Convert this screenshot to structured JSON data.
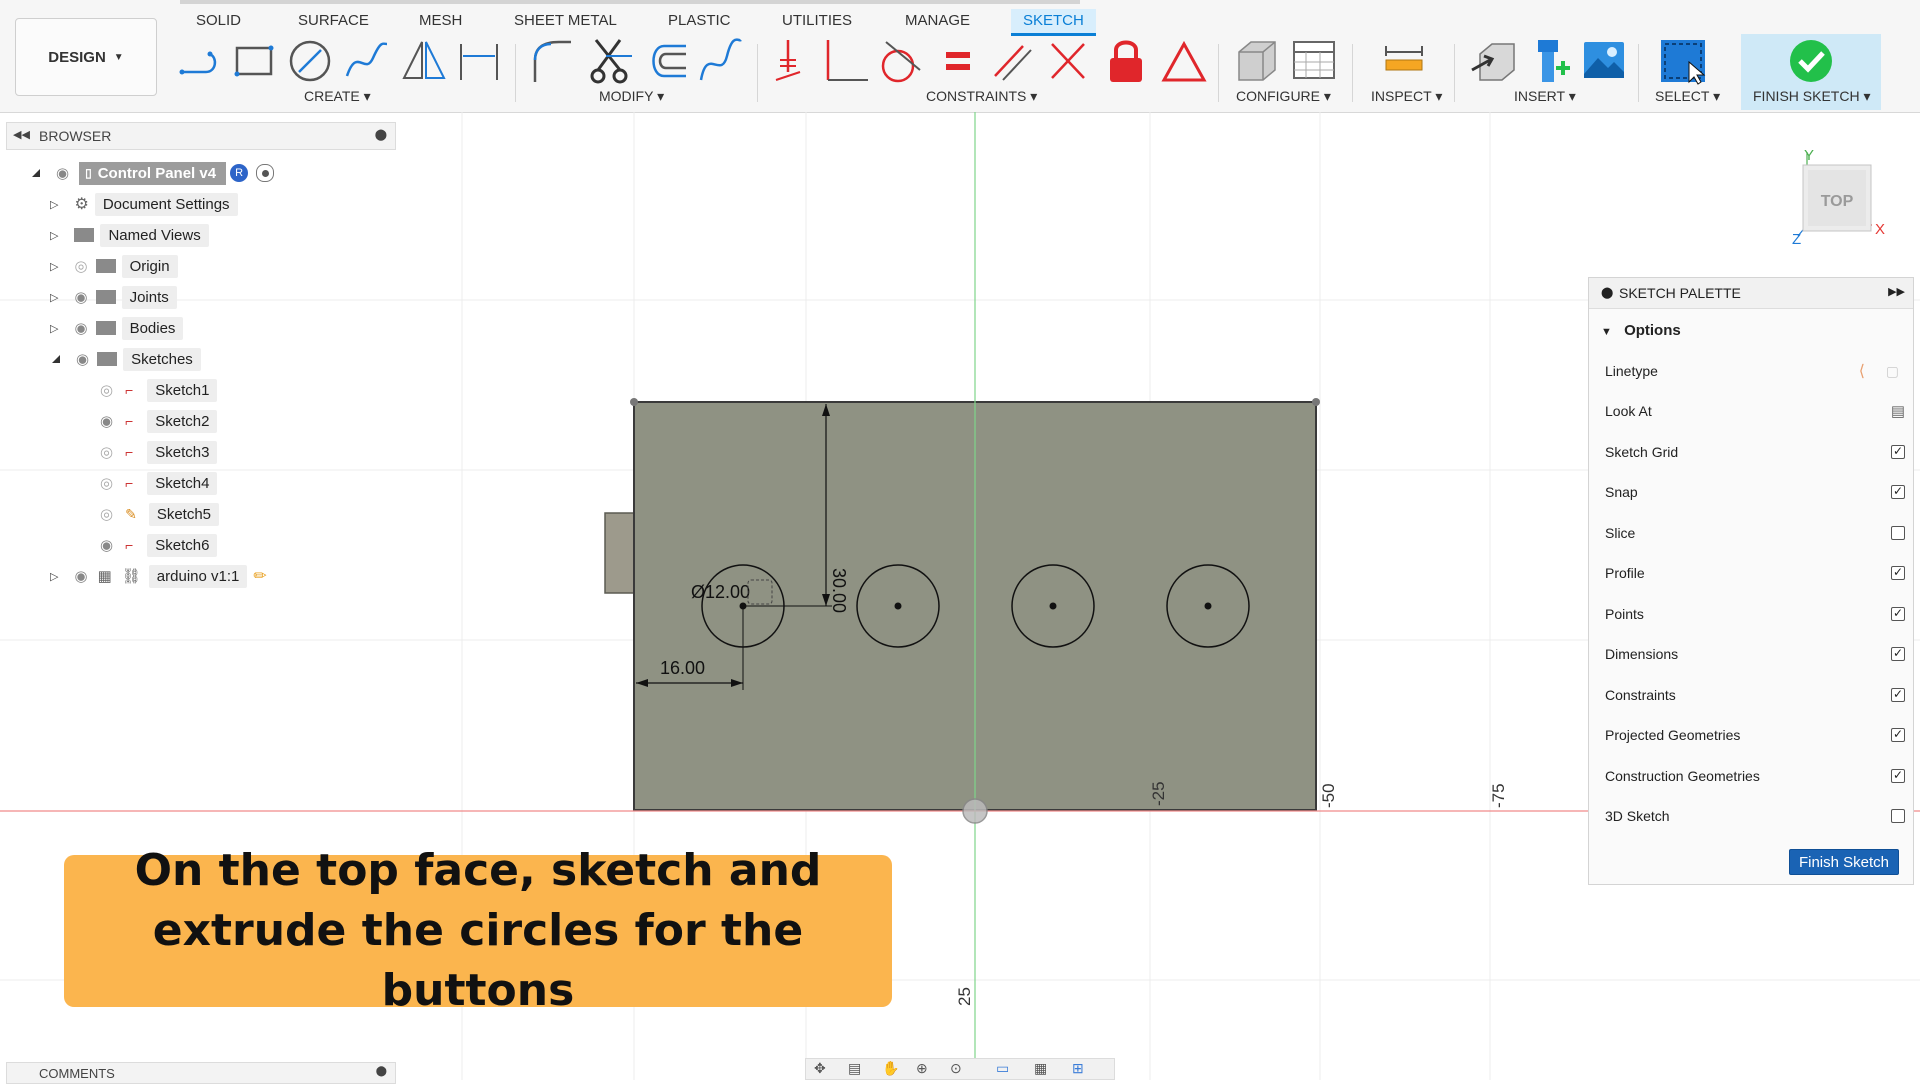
{
  "toolbar": {
    "workspace": "DESIGN",
    "tabs": [
      {
        "label": "SOLID"
      },
      {
        "label": "SURFACE"
      },
      {
        "label": "MESH"
      },
      {
        "label": "SHEET METAL"
      },
      {
        "label": "PLASTIC"
      },
      {
        "label": "UTILITIES"
      },
      {
        "label": "MANAGE"
      },
      {
        "label": "SKETCH"
      }
    ],
    "active_tab": "SKETCH",
    "groups": {
      "create": "CREATE ▾",
      "modify": "MODIFY ▾",
      "constraints": "CONSTRAINTS ▾",
      "configure": "CONFIGURE ▾",
      "inspect": "INSPECT ▾",
      "insert": "INSERT ▾",
      "select": "SELECT ▾",
      "finish": "FINISH SKETCH ▾"
    }
  },
  "browser": {
    "title": "BROWSER",
    "root": "Control Panel v4",
    "root_badge": "R",
    "items": [
      {
        "label": "Document Settings"
      },
      {
        "label": "Named Views"
      },
      {
        "label": "Origin"
      },
      {
        "label": "Joints"
      },
      {
        "label": "Bodies"
      },
      {
        "label": "Sketches"
      }
    ],
    "sketches": [
      {
        "label": "Sketch1"
      },
      {
        "label": "Sketch2"
      },
      {
        "label": "Sketch3"
      },
      {
        "label": "Sketch4"
      },
      {
        "label": "Sketch5"
      },
      {
        "label": "Sketch6"
      }
    ],
    "component": "arduino v1:1"
  },
  "viewport": {
    "dim_diameter": "Ø12.00",
    "dim_vertical": "30.00",
    "dim_horizontal": "16.00",
    "axis_labels": [
      "-25",
      "-50",
      "-75",
      "25"
    ],
    "viewcube_face": "TOP",
    "axes": {
      "y": "Y",
      "x": "X",
      "z": "Z"
    }
  },
  "palette": {
    "title": "SKETCH PALETTE",
    "section": "Options",
    "rows": [
      {
        "label": "Linetype"
      },
      {
        "label": "Look At"
      },
      {
        "label": "Sketch Grid",
        "checked": true
      },
      {
        "label": "Snap",
        "checked": true
      },
      {
        "label": "Slice",
        "checked": false
      },
      {
        "label": "Profile",
        "checked": true
      },
      {
        "label": "Points",
        "checked": true
      },
      {
        "label": "Dimensions",
        "checked": true
      },
      {
        "label": "Constraints",
        "checked": true
      },
      {
        "label": "Projected Geometries",
        "checked": true
      },
      {
        "label": "Construction Geometries",
        "checked": true
      },
      {
        "label": "3D Sketch",
        "checked": false
      }
    ],
    "finish_button": "Finish Sketch"
  },
  "caption": {
    "line1": "On the top face, sketch and",
    "line2": "extrude the circles for the buttons"
  },
  "comments": {
    "title": "COMMENTS"
  },
  "colors": {
    "accent": "#0a7fd6",
    "sketch_face": "#8f9283",
    "caption_bg": "#fbb54e",
    "finish_green": "#22c04a",
    "constraint_red": "#e0262b"
  }
}
